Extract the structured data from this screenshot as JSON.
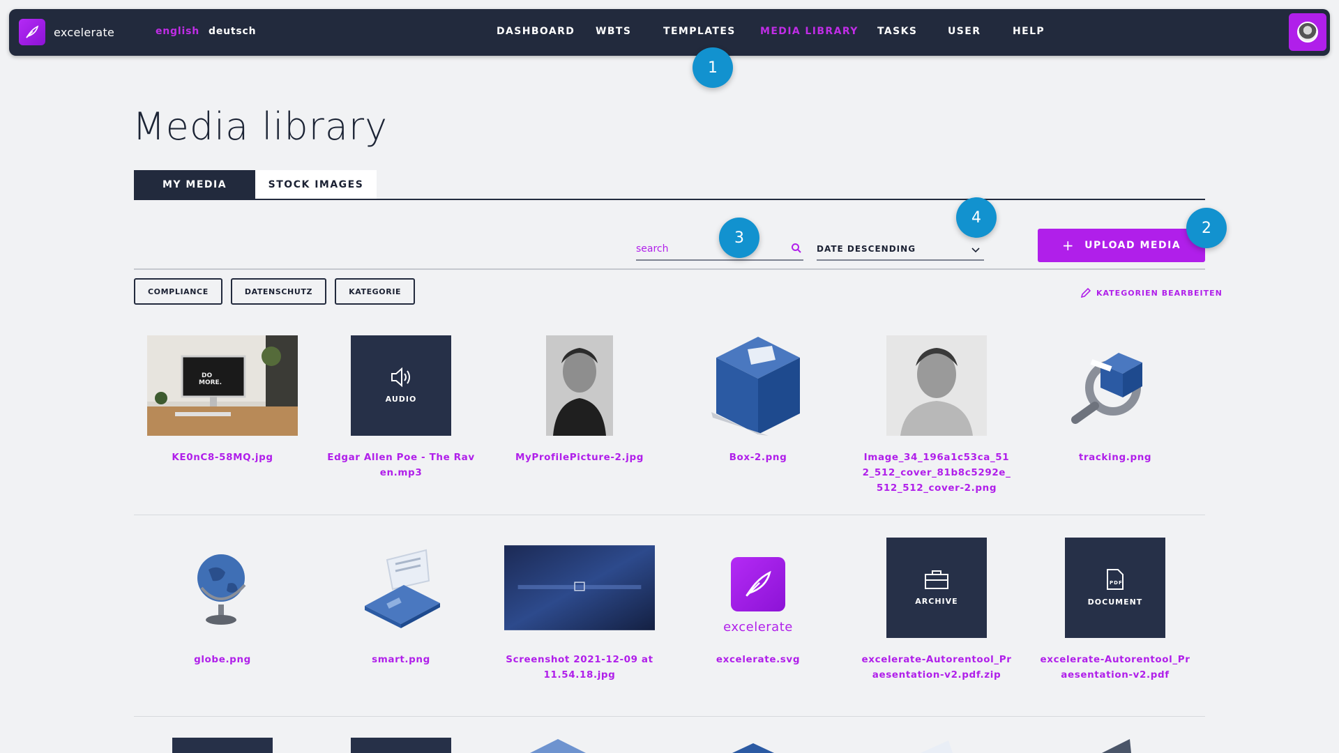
{
  "nav": {
    "brand": "excelerate",
    "languages": [
      "english",
      "deutsch"
    ],
    "items": [
      "DASHBOARD",
      "WBTS",
      "TEMPLATES",
      "MEDIA LIBRARY",
      "TASKS",
      "USER",
      "HELP"
    ],
    "active_item": "MEDIA LIBRARY"
  },
  "callouts": [
    "1",
    "2",
    "3",
    "4"
  ],
  "page": {
    "title": "Media library",
    "tabs": [
      "MY MEDIA",
      "STOCK IMAGES"
    ]
  },
  "toolbar": {
    "search_placeholder": "search",
    "sort_value": "DATE DESCENDING",
    "upload_label": "UPLOAD MEDIA",
    "upload_plus": "+"
  },
  "filters": {
    "chips": [
      "COMPLIANCE",
      "DATENSCHUTZ",
      "KATEGORIE"
    ],
    "edit_label": "KATEGORIEN BEARBEITEN"
  },
  "media": {
    "row1": [
      {
        "name": "KE0nC8-58MQ.jpg",
        "kind": "photo-desk"
      },
      {
        "name": "Edgar Allen Poe - The Raven.mp3",
        "kind": "audio",
        "label": "AUDIO"
      },
      {
        "name": "MyProfilePicture-2.jpg",
        "kind": "portrait"
      },
      {
        "name": "Box-2.png",
        "kind": "box"
      },
      {
        "name": "Image_34_196a1c53ca_512_512_cover_81b8c5292e_512_512_cover-2.png",
        "kind": "portrait"
      },
      {
        "name": "tracking.png",
        "kind": "tracking"
      }
    ],
    "row2": [
      {
        "name": "globe.png",
        "kind": "globe"
      },
      {
        "name": "smart.png",
        "kind": "smart"
      },
      {
        "name": "Screenshot 2021-12-09 at 11.54.18.jpg",
        "kind": "screenshot"
      },
      {
        "name": "excelerate.svg",
        "kind": "logo",
        "label": "excelerate"
      },
      {
        "name": "excelerate-Autorentool_Praesentation-v2.pdf.zip",
        "kind": "archive",
        "label": "ARCHIVE"
      },
      {
        "name": "excelerate-Autorentool_Praesentation-v2.pdf",
        "kind": "document",
        "label": "DOCUMENT",
        "badge": "PDF"
      }
    ]
  },
  "colors": {
    "accent": "#b01fea",
    "navy": "#222a3d",
    "callout": "#1292cf",
    "background": "#f1f2f4"
  }
}
